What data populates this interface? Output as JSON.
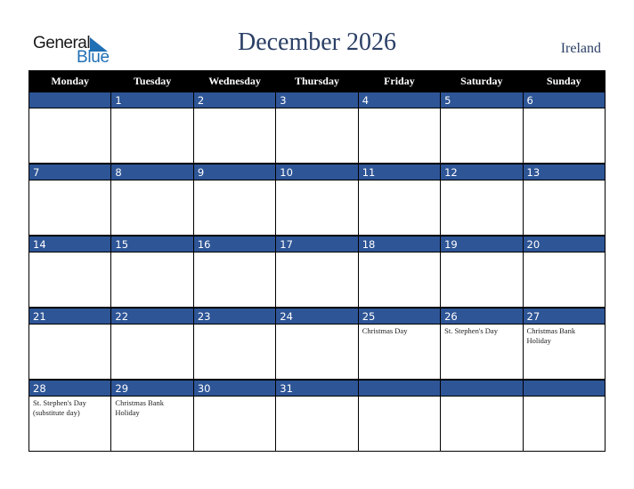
{
  "logo": {
    "general": "General",
    "blue": "Blue"
  },
  "title": "December 2026",
  "country": "Ireland",
  "weekdays": [
    "Monday",
    "Tuesday",
    "Wednesday",
    "Thursday",
    "Friday",
    "Saturday",
    "Sunday"
  ],
  "weeks": [
    {
      "days": [
        "",
        "1",
        "2",
        "3",
        "4",
        "5",
        "6"
      ],
      "events": [
        "",
        "",
        "",
        "",
        "",
        "",
        ""
      ]
    },
    {
      "days": [
        "7",
        "8",
        "9",
        "10",
        "11",
        "12",
        "13"
      ],
      "events": [
        "",
        "",
        "",
        "",
        "",
        "",
        ""
      ]
    },
    {
      "days": [
        "14",
        "15",
        "16",
        "17",
        "18",
        "19",
        "20"
      ],
      "events": [
        "",
        "",
        "",
        "",
        "",
        "",
        ""
      ]
    },
    {
      "days": [
        "21",
        "22",
        "23",
        "24",
        "25",
        "26",
        "27"
      ],
      "events": [
        "",
        "",
        "",
        "",
        "Christmas Day",
        "St. Stephen's Day",
        "Christmas Bank Holiday"
      ]
    },
    {
      "days": [
        "28",
        "29",
        "30",
        "31",
        "",
        "",
        ""
      ],
      "events": [
        "St. Stephen's Day (substitute day)",
        "Christmas Bank Holiday",
        "",
        "",
        "",
        "",
        ""
      ]
    }
  ],
  "colors": {
    "header_bg": "#000000",
    "week_bar": "#2e5596",
    "title": "#2b3f66",
    "logo_blue": "#1f6fb5"
  }
}
